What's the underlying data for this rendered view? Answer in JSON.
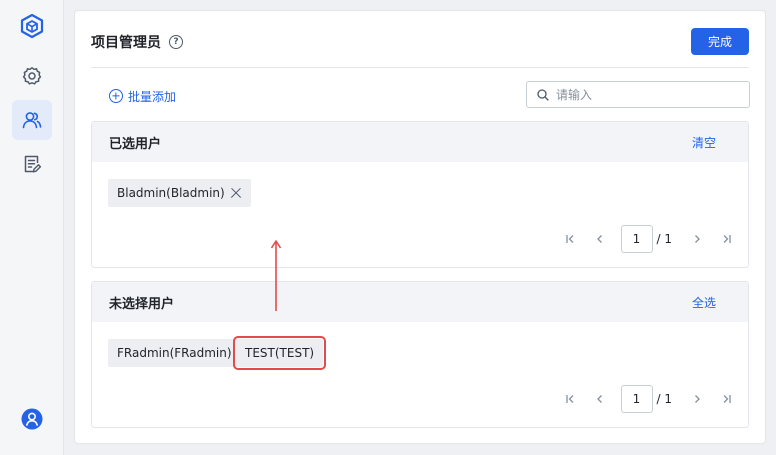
{
  "sidebar": {
    "items": [
      {
        "icon": "cube-logo-icon"
      },
      {
        "icon": "gear-icon"
      },
      {
        "icon": "users-icon",
        "active": true
      },
      {
        "icon": "edit-list-icon"
      }
    ],
    "bottom_icon": "user-avatar-icon"
  },
  "panel": {
    "title": "项目管理员",
    "help_icon": "?",
    "done_label": "完成",
    "batch_add_label": "批量添加",
    "search_placeholder": "请输入"
  },
  "selected": {
    "title": "已选用户",
    "action": "清空",
    "users": [
      {
        "label": "Bladmin(Bladmin)"
      }
    ],
    "pagination": {
      "page": "1",
      "total": "/ 1"
    }
  },
  "unselected": {
    "title": "未选择用户",
    "action": "全选",
    "users": [
      {
        "label": "FRadmin(FRadmin)"
      },
      {
        "label": "TEST(TEST)",
        "highlighted": true
      }
    ],
    "pagination": {
      "page": "1",
      "total": "/ 1"
    }
  },
  "colors": {
    "accent": "#2462e8",
    "highlight": "#e24b4b",
    "sidebar_active": "#e3eaf9"
  }
}
